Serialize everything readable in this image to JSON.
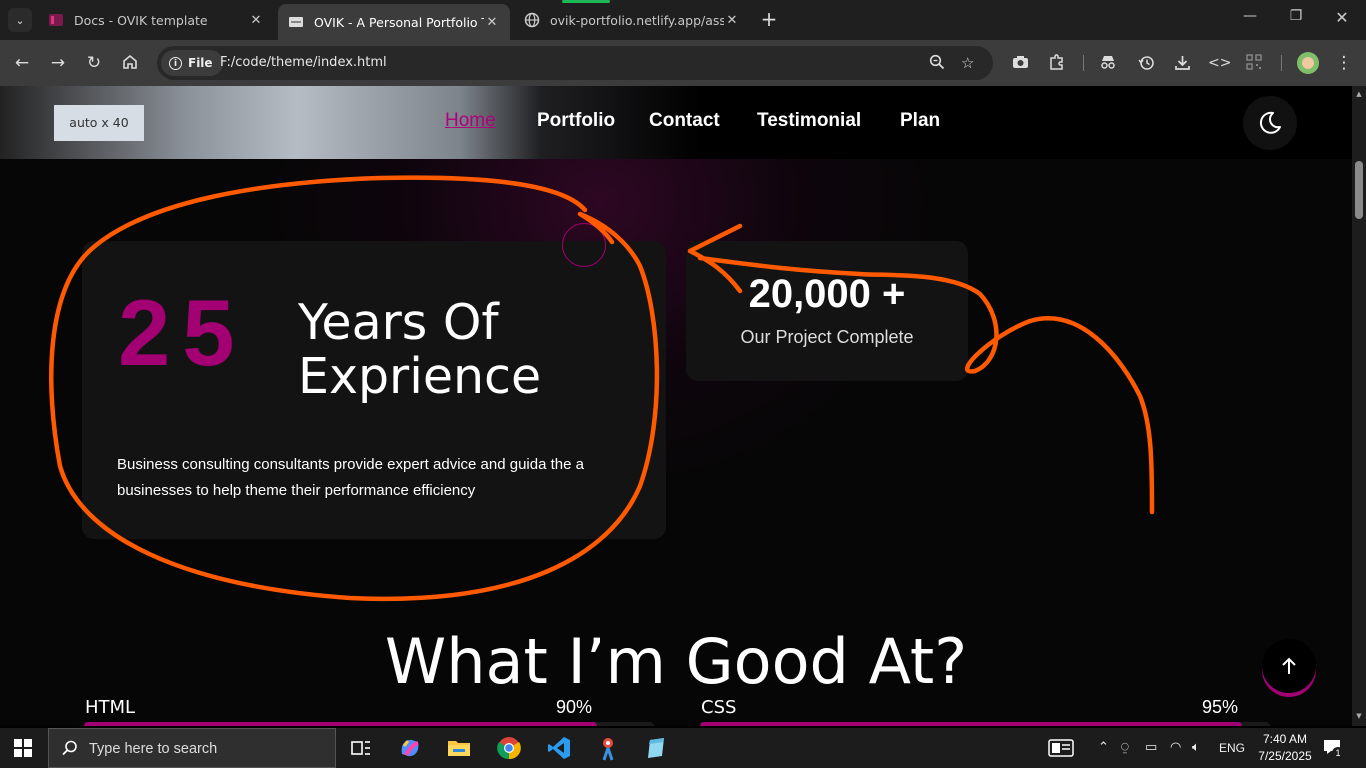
{
  "browser": {
    "tabs": [
      {
        "title": "Docs - OVIK template",
        "close": "✕"
      },
      {
        "title": "OVIK - A Personal Portfolio Tem",
        "close": "✕"
      },
      {
        "title": "ovik-portfolio.netlify.app/assets",
        "close": "✕"
      }
    ],
    "new_tab": "+",
    "address": {
      "chip_label": "File",
      "url": "F:/code/theme/index.html"
    }
  },
  "site": {
    "logo_placeholder": "auto x 40",
    "nav": [
      "Home",
      "Portfolio",
      "Contact",
      "Testimonial",
      "Plan"
    ],
    "experience": {
      "number": "25",
      "title_line1": "Years Of",
      "title_line2": "Exprience",
      "description": "Business consulting consultants provide expert advice and guida the a businesses to help theme their performance efficiency"
    },
    "projects": {
      "count": "20,000 +",
      "label": "Our Project Complete"
    },
    "skills_heading": "What I’m Good At?",
    "skills": [
      {
        "name": "HTML",
        "percent_label": "90%",
        "level": 0.9
      },
      {
        "name": "CSS",
        "percent_label": "95%",
        "level": 0.95
      }
    ],
    "accent_color": "#a30073"
  },
  "taskbar": {
    "search_placeholder": "Type here to search",
    "language": "ENG",
    "time": "7:40 AM",
    "date": "7/25/2025",
    "notification_count": "1"
  },
  "annotation_color": "#ff5a00"
}
